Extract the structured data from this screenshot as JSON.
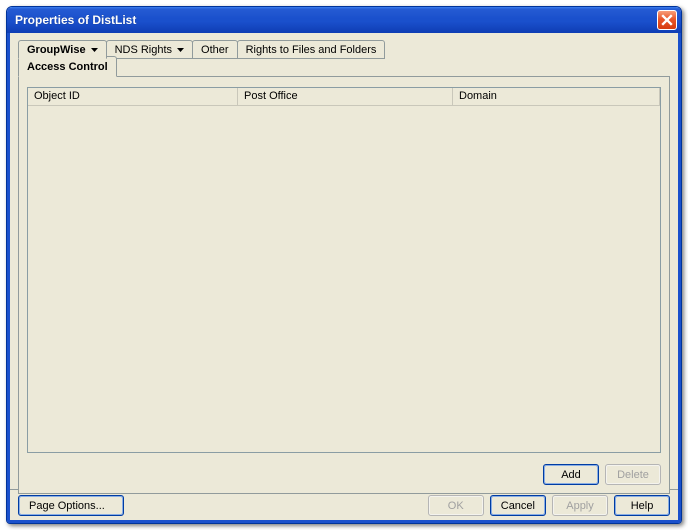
{
  "window": {
    "title": "Properties of DistList"
  },
  "tabs_row1": [
    {
      "label": "GroupWise",
      "has_menu": true
    },
    {
      "label": "NDS Rights",
      "has_menu": true
    },
    {
      "label": "Other",
      "has_menu": false
    },
    {
      "label": "Rights to Files and Folders",
      "has_menu": false
    }
  ],
  "tabs_row2": [
    {
      "label": "Access Control",
      "active": true
    }
  ],
  "list": {
    "columns": {
      "object_id": "Object ID",
      "post_office": "Post Office",
      "domain": "Domain"
    },
    "rows": []
  },
  "panel_buttons": {
    "add": "Add",
    "delete": "Delete"
  },
  "bottom_buttons": {
    "page_options": "Page Options...",
    "ok": "OK",
    "cancel": "Cancel",
    "apply": "Apply",
    "help": "Help"
  }
}
